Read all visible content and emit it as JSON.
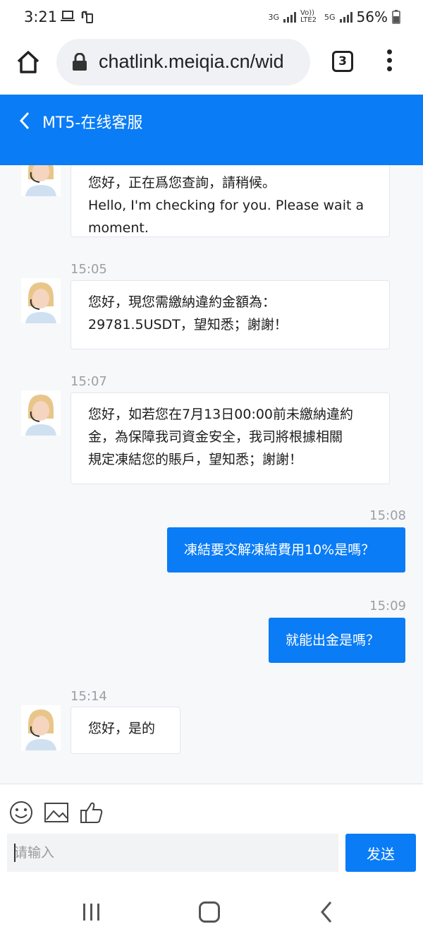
{
  "status_bar": {
    "time": "3:21",
    "network_3g": "3G",
    "volte": "Vo)) LTE2",
    "network_5g": "5G",
    "battery": "56%"
  },
  "browser": {
    "url": "chatlink.meiqia.cn/wid",
    "tab_count": "3"
  },
  "chat": {
    "title": "MT5-在线客服",
    "messages": [
      {
        "side": "in",
        "time": "",
        "text": "您好，正在爲您查詢，請稍候。\nHello, I'm checking for you. Please wait a\nmoment."
      },
      {
        "side": "in",
        "time": "15:05",
        "text": "您好，現您需繳納違約金額為：\n29781.5USDT，望知悉；謝謝！"
      },
      {
        "side": "in",
        "time": "15:07",
        "text": "您好，如若您在7月13日00:00前未繳納違約\n金，為保障我司資金安全，我司將根據相關\n規定凍結您的賬戶，望知悉；謝謝！"
      },
      {
        "side": "out",
        "time": "15:08",
        "text": "凍結要交解凍結費用10%是嗎？"
      },
      {
        "side": "out",
        "time": "15:09",
        "text": "就能出金是嗎？"
      },
      {
        "side": "in",
        "time": "15:14",
        "text": "您好，是的"
      }
    ]
  },
  "composer": {
    "placeholder": "请输入",
    "send_label": "发送",
    "icons": [
      "emoji-icon",
      "image-icon",
      "thumbs-up-icon"
    ]
  },
  "colors": {
    "accent": "#0a7cf6",
    "chat_bg": "#f7f8fa"
  }
}
